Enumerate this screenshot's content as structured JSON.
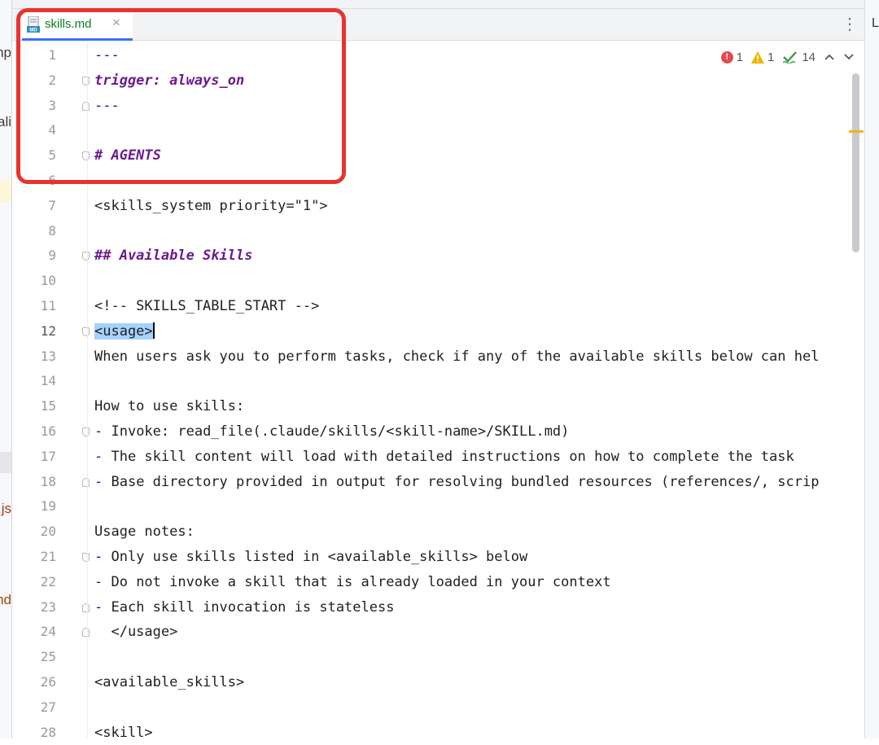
{
  "left_panel": {
    "fragments": [
      {
        "text": "np",
        "color": "#3c3c3c"
      },
      {
        "text": "ali",
        "color": "#3c3c3c"
      },
      {
        "text": ".js",
        "color": "#b0361b"
      },
      {
        "text": "md",
        "color": "#a0430f"
      }
    ]
  },
  "tab": {
    "icon": "markdown-file-icon",
    "label": "skills.md",
    "close_icon": "close-icon"
  },
  "tab_bar": {
    "menu_icon": "more-vertical-icon"
  },
  "right_panel": {
    "letter": "L"
  },
  "inspections": {
    "errors": "1",
    "warnings": "1",
    "typos": "14",
    "up_icon": "chevron-up-icon",
    "down_icon": "chevron-down-icon"
  },
  "editor": {
    "current_line": 12,
    "lines": [
      "---",
      "trigger: always_on",
      "---",
      "",
      "# AGENTS",
      "",
      "<skills_system priority=\"1\">",
      "",
      "## Available Skills",
      "",
      "<!-- SKILLS_TABLE_START -->",
      "<usage>",
      "When users ask you to perform tasks, check if any of the available skills below can hel",
      "",
      "How to use skills:",
      "- Invoke: read_file(.claude/skills/<skill-name>/SKILL.md)",
      "- The skill content will load with detailed instructions on how to complete the task",
      "- Base directory provided in output for resolving bundled resources (references/, scrip",
      "",
      "Usage notes:",
      "- Only use skills listed in <available_skills> below",
      "- Do not invoke a skill that is already loaded in your context",
      "- Each skill invocation is stateless",
      "  </usage>",
      "",
      "<available_skills>",
      "",
      "<skill>"
    ]
  },
  "colors": {
    "accent": "#3574f0",
    "tab_label": "#0a7e22",
    "heading": "#6b1b8f",
    "frontmatter": "#0b1d8a",
    "highlight_box": "#e8332f",
    "selection": "#a6d2ff"
  }
}
